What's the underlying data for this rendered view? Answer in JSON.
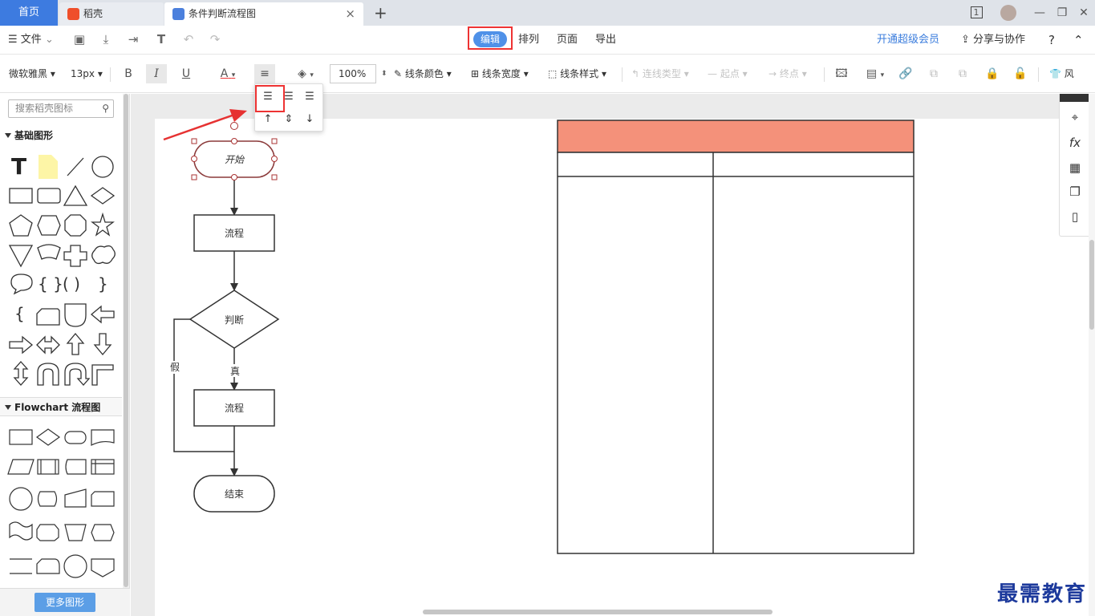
{
  "tabs": {
    "home": "首页",
    "tab1": "稻壳",
    "tab2": "条件判断流程图",
    "new_tab": "+",
    "page_count": "1"
  },
  "window_controls": {
    "minimize": "—",
    "restore": "❐",
    "close": "✕"
  },
  "menu": {
    "file": "文件",
    "modes": [
      "编辑",
      "排列",
      "页面",
      "导出"
    ],
    "active_mode": "编辑",
    "vip": "开通超级会员",
    "share": "分享与协作",
    "help": "?"
  },
  "toolbar": {
    "font": "微软雅黑",
    "size": "13px",
    "bold": "B",
    "italic": "I",
    "underline": "U",
    "font_color": "A",
    "zoom": "100%",
    "line_color": "线条颜色",
    "line_width": "线条宽度",
    "line_style": "线条样式",
    "connector": "连线类型",
    "start": "起点",
    "end": "终点",
    "more": "风"
  },
  "align_popup": {
    "selected": "align-left"
  },
  "sidebar": {
    "search_placeholder": "搜索稻壳图标",
    "basic_title": "基础图形",
    "flowchart_title": "Flowchart 流程图",
    "more_button": "更多图形"
  },
  "flowchart": {
    "start": "开始",
    "process1": "流程",
    "decision": "判断",
    "true_label": "真",
    "false_label": "假",
    "process2": "流程",
    "end": "结束"
  },
  "table": {
    "header_color": "#f4917a"
  },
  "watermark": "最需教育",
  "colors": {
    "accent": "#4f91e8",
    "home_tab": "#3d7be0",
    "highlight_red": "#e33333"
  }
}
